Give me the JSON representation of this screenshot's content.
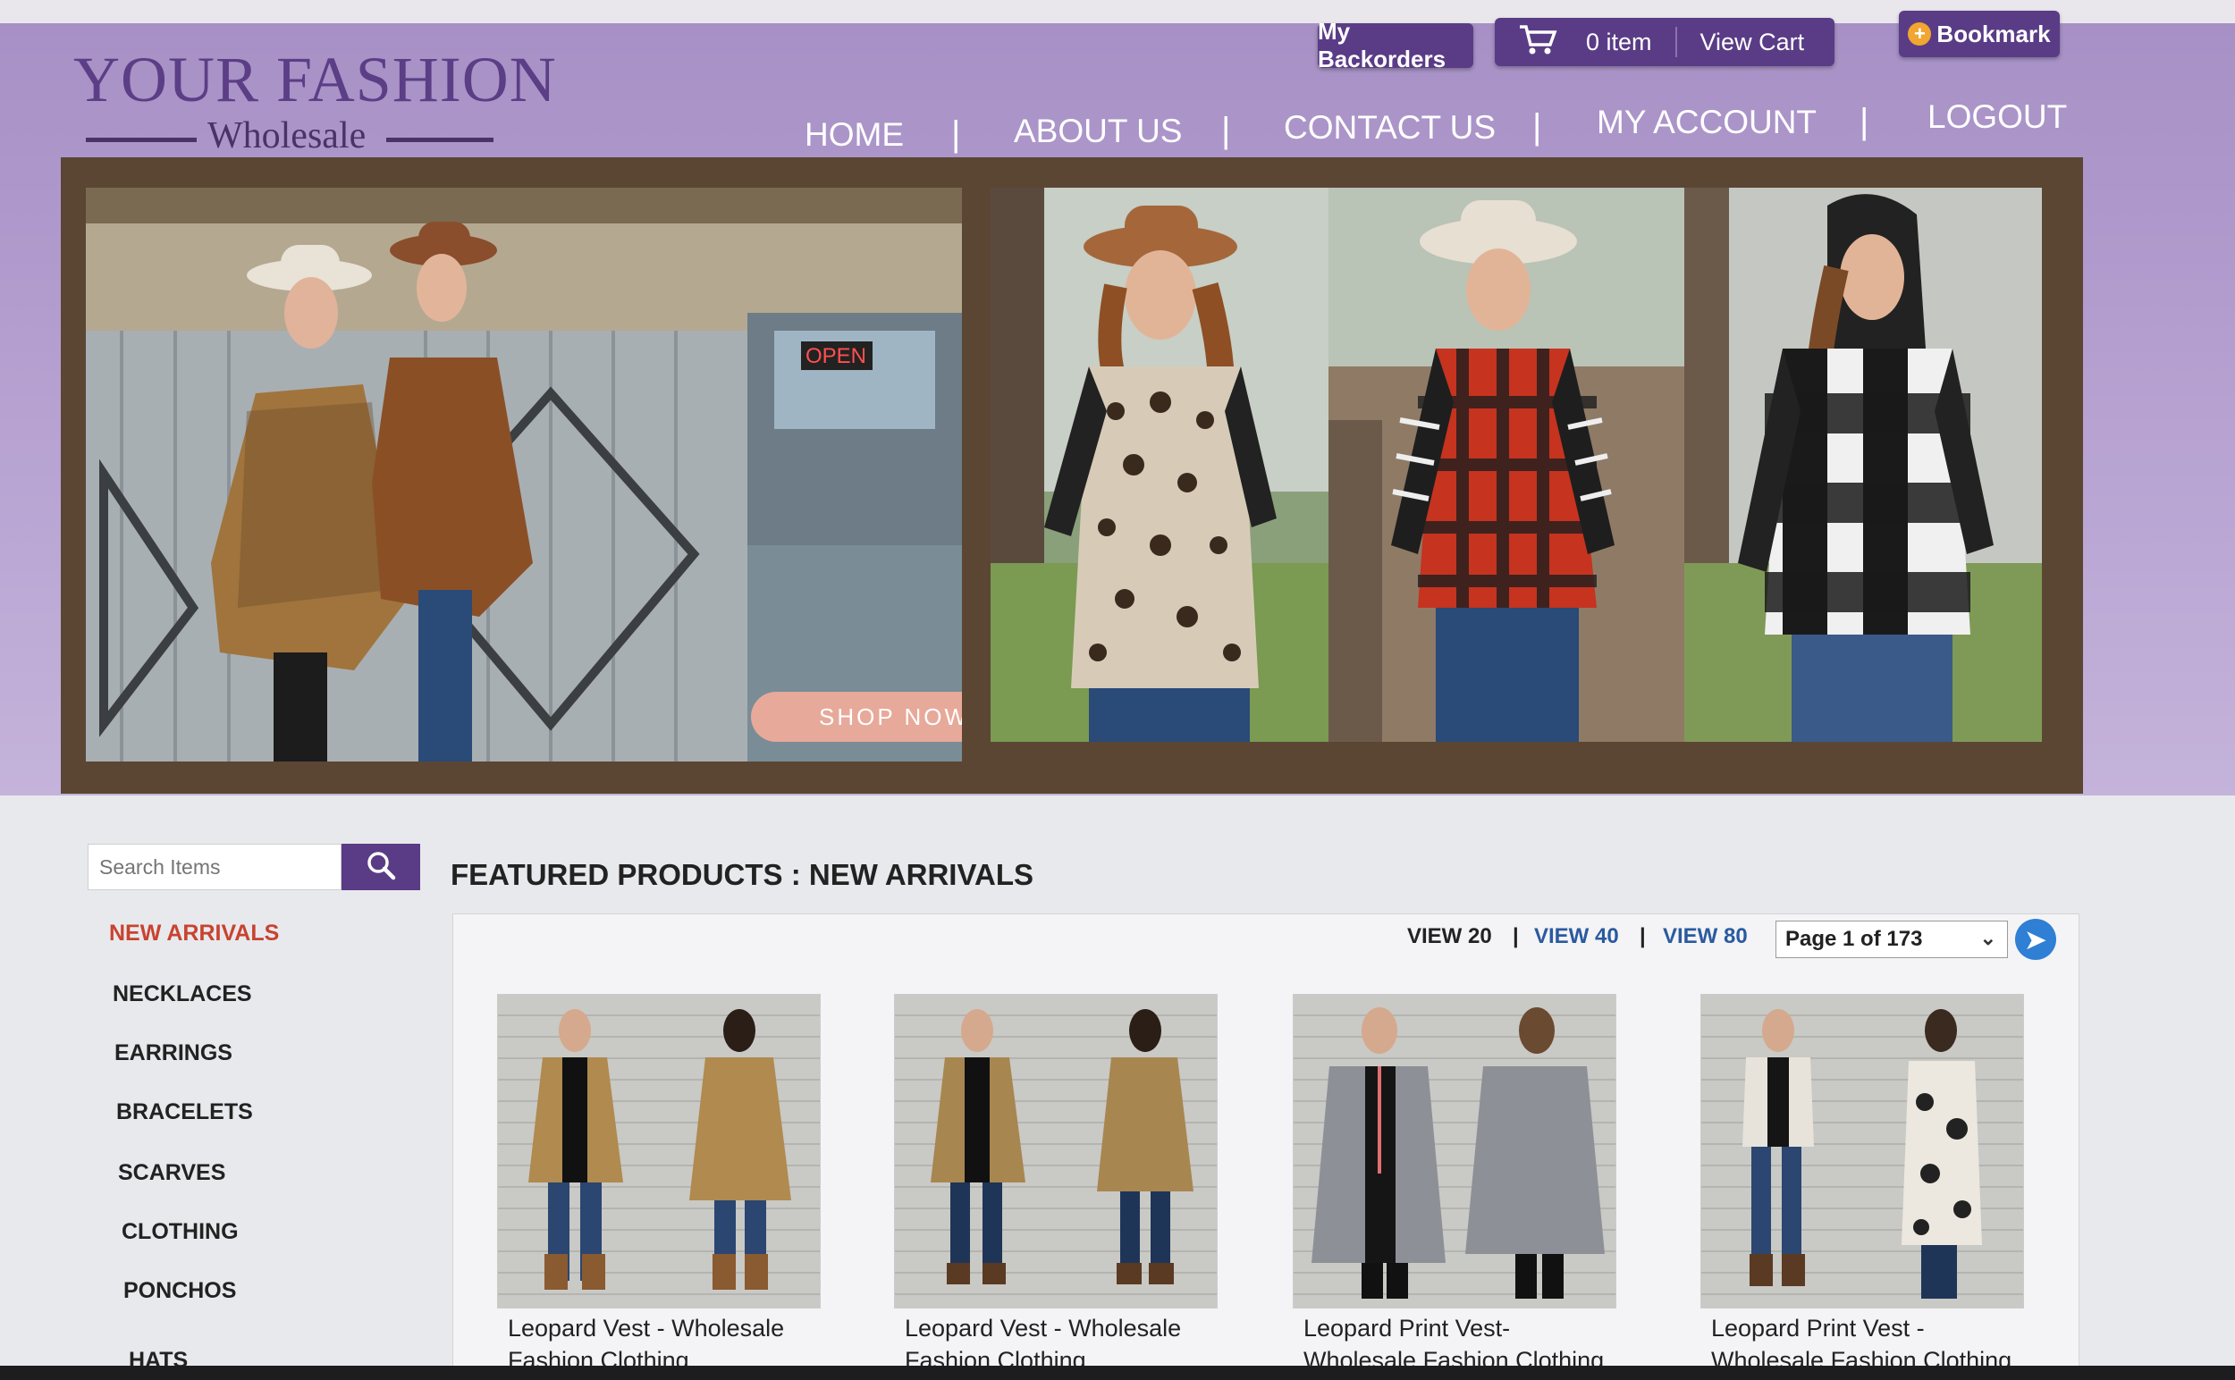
{
  "logo": {
    "main": "YOUR FASHION",
    "sub": "Wholesale"
  },
  "topbar": {
    "backorders": "My Backorders",
    "cart_count": "0 item",
    "view_cart": "View Cart",
    "bookmark": "Bookmark"
  },
  "nav": {
    "items": [
      "HOME",
      "ABOUT US",
      "CONTACT US",
      "MY ACCOUNT",
      "LOGOUT"
    ],
    "separator": "|"
  },
  "banner": {
    "button": "SHOP NOW",
    "sign_text": "OPEN"
  },
  "search": {
    "placeholder": "Search Items"
  },
  "sidebar": {
    "items": [
      "NEW ARRIVALS",
      "NECKLACES",
      "EARRINGS",
      "BRACELETS",
      "SCARVES",
      "CLOTHING",
      "PONCHOS",
      "HATS"
    ],
    "active_color": "#c8432f"
  },
  "featured": {
    "title": "FEATURED PRODUCTS : NEW ARRIVALS"
  },
  "pagination": {
    "view_options": [
      "VIEW 20",
      "VIEW 40",
      "VIEW 80"
    ],
    "separator": "|",
    "page_select": "Page 1 of 173"
  },
  "products": [
    {
      "line1": "Leopard Vest - Wholesale",
      "line2": "Fashion Clothing"
    },
    {
      "line1": "Leopard Vest - Wholesale",
      "line2": "Fashion Clothing"
    },
    {
      "line1": "Leopard Print Vest-",
      "line2": "Wholesale Fashion Clothing"
    },
    {
      "line1": "Leopard Print Vest -",
      "line2": "Wholesale Fashion Clothing"
    }
  ],
  "colors": {
    "brand_purple": "#5a3c86",
    "header_lavender": "#b39dcf",
    "link_blue": "#2a5aa0",
    "go_button": "#2f7fd4"
  },
  "icons": [
    "cart-icon",
    "bookmark-plus-icon",
    "search-icon",
    "chevron-down-icon",
    "arrow-right-icon"
  ]
}
